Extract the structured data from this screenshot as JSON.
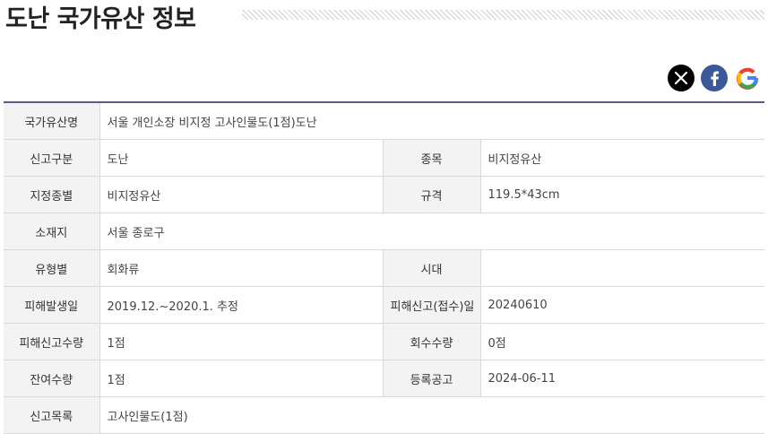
{
  "page": {
    "title": "도난 국가유산 정보"
  },
  "share": {
    "icons": [
      "x-icon",
      "facebook-icon",
      "google-icon"
    ]
  },
  "colors": {
    "accent_border": "#5b5a8e",
    "header_bg": "#f3f3f3",
    "x": "#000000",
    "facebook": "#3b5998"
  },
  "rows": [
    {
      "label": "국가유산명",
      "value": "서울 개인소장 비지정 고사인물도(1점)도난"
    },
    {
      "label": "신고구분",
      "value": "도난",
      "label2": "종목",
      "value2": "비지정유산"
    },
    {
      "label": "지정종별",
      "value": "비지정유산",
      "label2": "규격",
      "value2": "119.5*43cm"
    },
    {
      "label": "소재지",
      "value": "서울 종로구"
    },
    {
      "label": "유형별",
      "value": "회화류",
      "label2": "시대",
      "value2": ""
    },
    {
      "label": "피해발생일",
      "value": "2019.12.~2020.1. 추정",
      "label2": "피해신고(접수)일",
      "value2": "20240610"
    },
    {
      "label": "피해신고수량",
      "value": "1점",
      "label2": "회수수량",
      "value2": "0점"
    },
    {
      "label": "잔여수량",
      "value": "1점",
      "label2": "등록공고",
      "value2": "2024-06-11"
    },
    {
      "label": "신고목록",
      "value": "고사인물도(1점)"
    }
  ]
}
